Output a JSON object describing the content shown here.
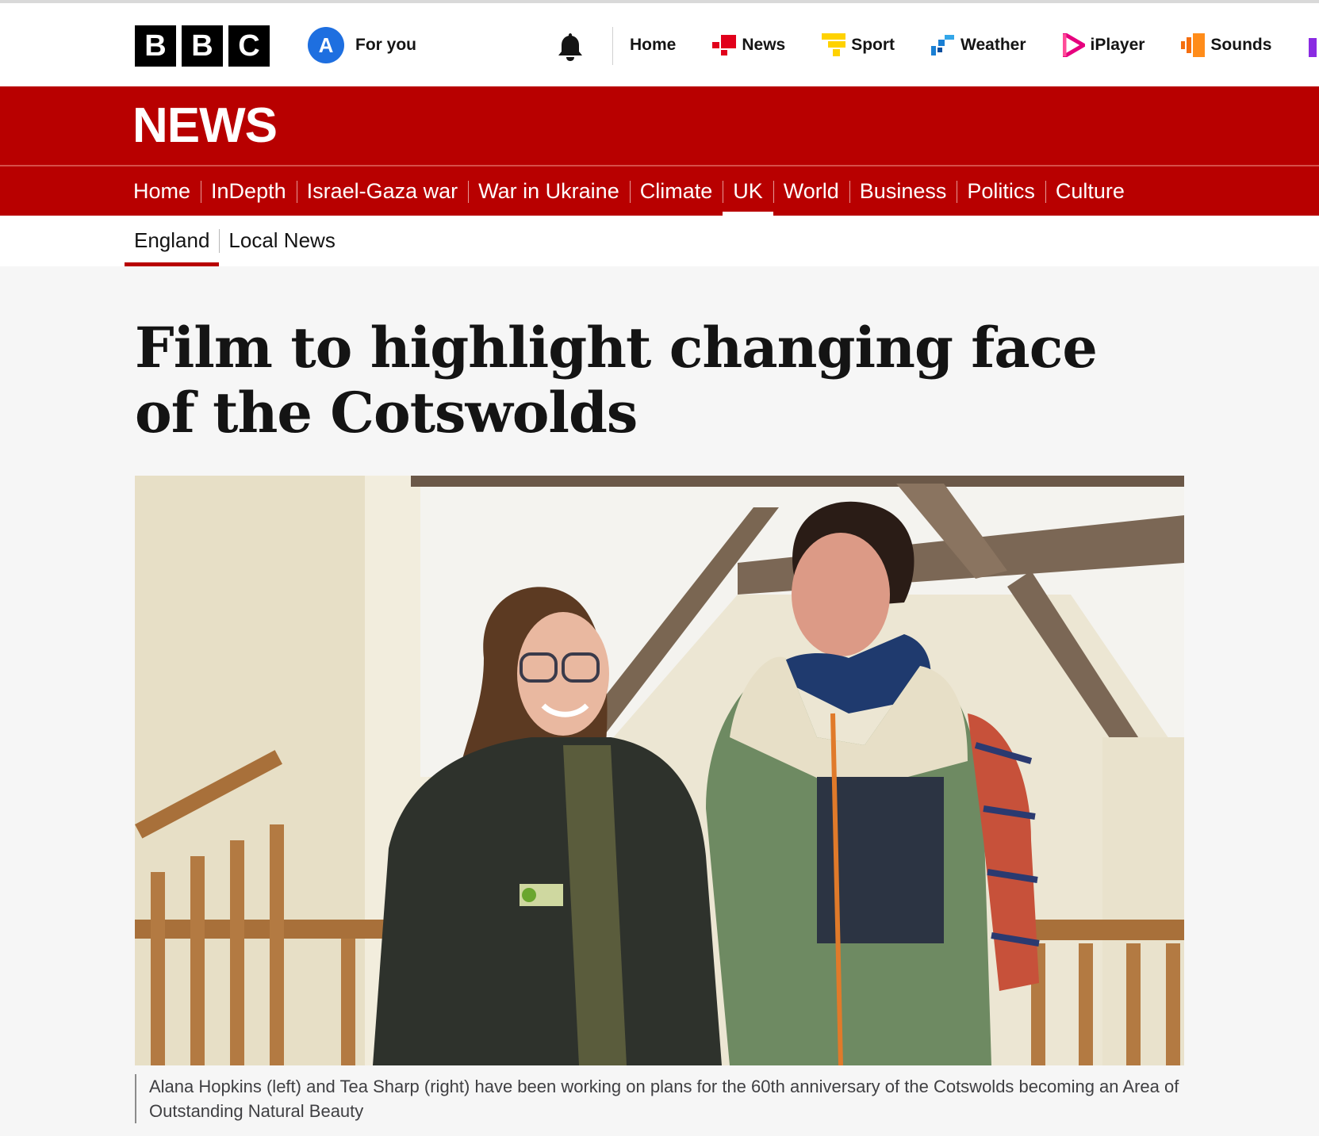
{
  "header": {
    "logo_letters": [
      "B",
      "B",
      "C"
    ],
    "account_initial": "A",
    "for_you_label": "For you",
    "nav": [
      {
        "label": "Home",
        "icon": "none"
      },
      {
        "label": "News",
        "icon": "news-icon"
      },
      {
        "label": "Sport",
        "icon": "sport-icon"
      },
      {
        "label": "Weather",
        "icon": "weather-icon"
      },
      {
        "label": "iPlayer",
        "icon": "iplayer-icon"
      },
      {
        "label": "Sounds",
        "icon": "sounds-icon"
      }
    ]
  },
  "masthead": {
    "title": "NEWS",
    "sections": [
      "Home",
      "InDepth",
      "Israel-Gaza war",
      "War in Ukraine",
      "Climate",
      "UK",
      "World",
      "Business",
      "Politics",
      "Culture"
    ],
    "active_section": "UK"
  },
  "subnav": {
    "items": [
      "England",
      "Local News"
    ],
    "active": "England"
  },
  "article": {
    "headline": "Film to highlight changing face of the Cotswolds",
    "caption": "Alana Hopkins (left) and Tea Sharp (right) have been working on plans for the 60th anniversary of the Cotswolds becoming an Area of Outstanding Natural Beauty"
  },
  "colors": {
    "news_red": "#b80000",
    "account_blue": "#1e6fe0",
    "news_icon": "#e1001b",
    "sport_icon": "#ffd200",
    "weather_icon": "#1a7fd4",
    "iplayer_icon": "#e6007e",
    "sounds_icon": "#f56e0f"
  }
}
